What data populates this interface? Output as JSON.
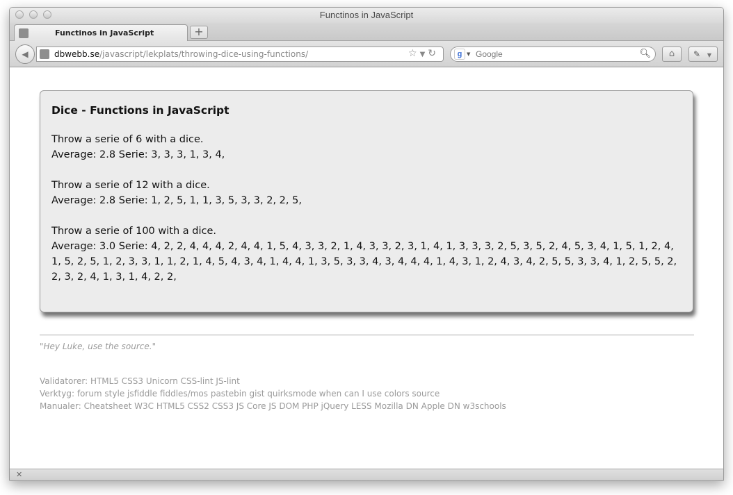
{
  "window": {
    "title": "Functinos in JavaScript"
  },
  "tab": {
    "label": "Functinos in JavaScript",
    "new_tab": "+"
  },
  "navbar": {
    "url_domain": "dbwebb.se",
    "url_path": "/javascript/lekplats/throwing-dice-using-functions/",
    "search_placeholder": "Google"
  },
  "content": {
    "heading": "Dice - Functions in JavaScript",
    "throws": [
      {
        "intro": "Throw a serie of 6 with a dice.",
        "result": "Average: 2.8 Serie: 3, 3, 3, 1, 3, 4,"
      },
      {
        "intro": "Throw a serie of 12 with a dice.",
        "result": "Average: 2.8 Serie: 1, 2, 5, 1, 1, 3, 5, 3, 3, 2, 2, 5,"
      },
      {
        "intro": "Throw a serie of 100 with a dice.",
        "result_line1": "Average: 3.0 Serie: 4, 2, 2, 4, 4, 4, 2, 4, 4, 1, 5, 4, 3, 3, 2, 1, 4, 3, 3, 2, 3, 1, 4, 1, 3, 3, 3, 2, 5, 3, 5, 2, 4, 5, 3, 4, 1, 5, 1, 2, 4,",
        "result_line2": "1, 5, 2, 5, 1, 2, 3, 3, 1, 1, 2, 1, 4, 5, 4, 3, 4, 1, 4, 4, 1, 3, 5, 3, 3, 4, 3, 4, 4, 4, 1, 4, 3, 1, 2, 4, 3, 4, 2, 5, 5, 3, 3, 4, 1, 2, 5, 5, 2,",
        "result_line3": "2, 3, 2, 4, 1, 3, 1, 4, 2, 2,"
      }
    ]
  },
  "footer": {
    "quote": "\"Hey Luke, use the source.\"",
    "validators": "Validatorer: HTML5 CSS3 Unicorn CSS-lint JS-lint",
    "tools": "Verktyg: forum style jsfiddle fiddles/mos pastebin gist quirksmode when can I use colors source",
    "manuals": "Manualer: Cheatsheet W3C HTML5 CSS2 CSS3 JS Core JS DOM PHP jQuery LESS Mozilla DN Apple DN w3schools"
  },
  "icons": {
    "back": "back-arrow-icon",
    "bookmark": "star-icon",
    "reload": "reload-icon",
    "search": "magnifier-icon",
    "home": "home-icon",
    "tools": "eyedropper-icon"
  }
}
